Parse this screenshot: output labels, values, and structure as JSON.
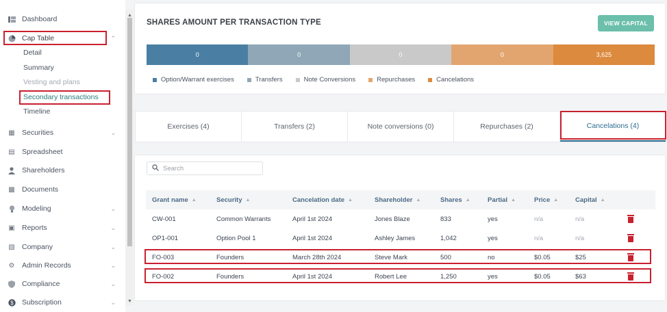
{
  "sidebar": {
    "items": [
      {
        "label": "Dashboard",
        "icon": "dashboard-icon"
      },
      {
        "label": "Cap Table",
        "icon": "pie-chart-icon"
      },
      {
        "label": "Securities",
        "icon": "securities-icon"
      },
      {
        "label": "Spreadsheet",
        "icon": "spreadsheet-icon"
      },
      {
        "label": "Shareholders",
        "icon": "person-icon"
      },
      {
        "label": "Documents",
        "icon": "document-icon"
      },
      {
        "label": "Modeling",
        "icon": "lightbulb-icon"
      },
      {
        "label": "Reports",
        "icon": "reports-icon"
      },
      {
        "label": "Company",
        "icon": "building-icon"
      },
      {
        "label": "Admin Records",
        "icon": "admin-icon"
      },
      {
        "label": "Compliance",
        "icon": "shield-icon"
      },
      {
        "label": "Subscription",
        "icon": "dollar-icon"
      }
    ],
    "cap_table_sub": [
      {
        "label": "Detail"
      },
      {
        "label": "Summary"
      },
      {
        "label": "Vesting and plans"
      },
      {
        "label": "Secondary transactions"
      },
      {
        "label": "Timeline"
      }
    ]
  },
  "summary": {
    "title": "SHARES AMOUNT PER TRANSACTION TYPE",
    "view_button": "VIEW CAPITAL",
    "segments": [
      {
        "value": "0",
        "color": "#4a7fa3"
      },
      {
        "value": "0",
        "color": "#8fa7b6"
      },
      {
        "value": "0",
        "color": "#c9c9c9"
      },
      {
        "value": "0",
        "color": "#e3a56f"
      },
      {
        "value": "3,625",
        "color": "#dc8a3d"
      }
    ],
    "legend": [
      {
        "label": "Option/Warrant exercises",
        "color": "#4a7fa3"
      },
      {
        "label": "Transfers",
        "color": "#8fa7b6"
      },
      {
        "label": "Note Conversions",
        "color": "#c9c9c9"
      },
      {
        "label": "Repurchases",
        "color": "#e3a56f"
      },
      {
        "label": "Cancelations",
        "color": "#dc8a3d"
      }
    ]
  },
  "tabs": [
    {
      "label": "Exercises (4)"
    },
    {
      "label": "Transfers (2)"
    },
    {
      "label": "Note conversions (0)"
    },
    {
      "label": "Repurchases (2)"
    },
    {
      "label": "Cancelations (4)"
    }
  ],
  "search": {
    "placeholder": "Search"
  },
  "table": {
    "headers": [
      "Grant name",
      "Security",
      "Cancelation date",
      "Shareholder",
      "Shares",
      "Partial",
      "Price",
      "Capital"
    ],
    "rows": [
      [
        "CW-001",
        "Common Warrants",
        "April 1st 2024",
        "Jones Blaze",
        "833",
        "yes",
        "n/a",
        "n/a"
      ],
      [
        "OP1-001",
        "Option Pool 1",
        "April 1st 2024",
        "Ashley James",
        "1,042",
        "yes",
        "n/a",
        "n/a"
      ],
      [
        "FO-003",
        "Founders",
        "March 28th 2024",
        "Steve Mark",
        "500",
        "no",
        "$0.05",
        "$25"
      ],
      [
        "FO-002",
        "Founders",
        "April 1st 2024",
        "Robert Lee",
        "1,250",
        "yes",
        "$0.05",
        "$63"
      ]
    ]
  }
}
